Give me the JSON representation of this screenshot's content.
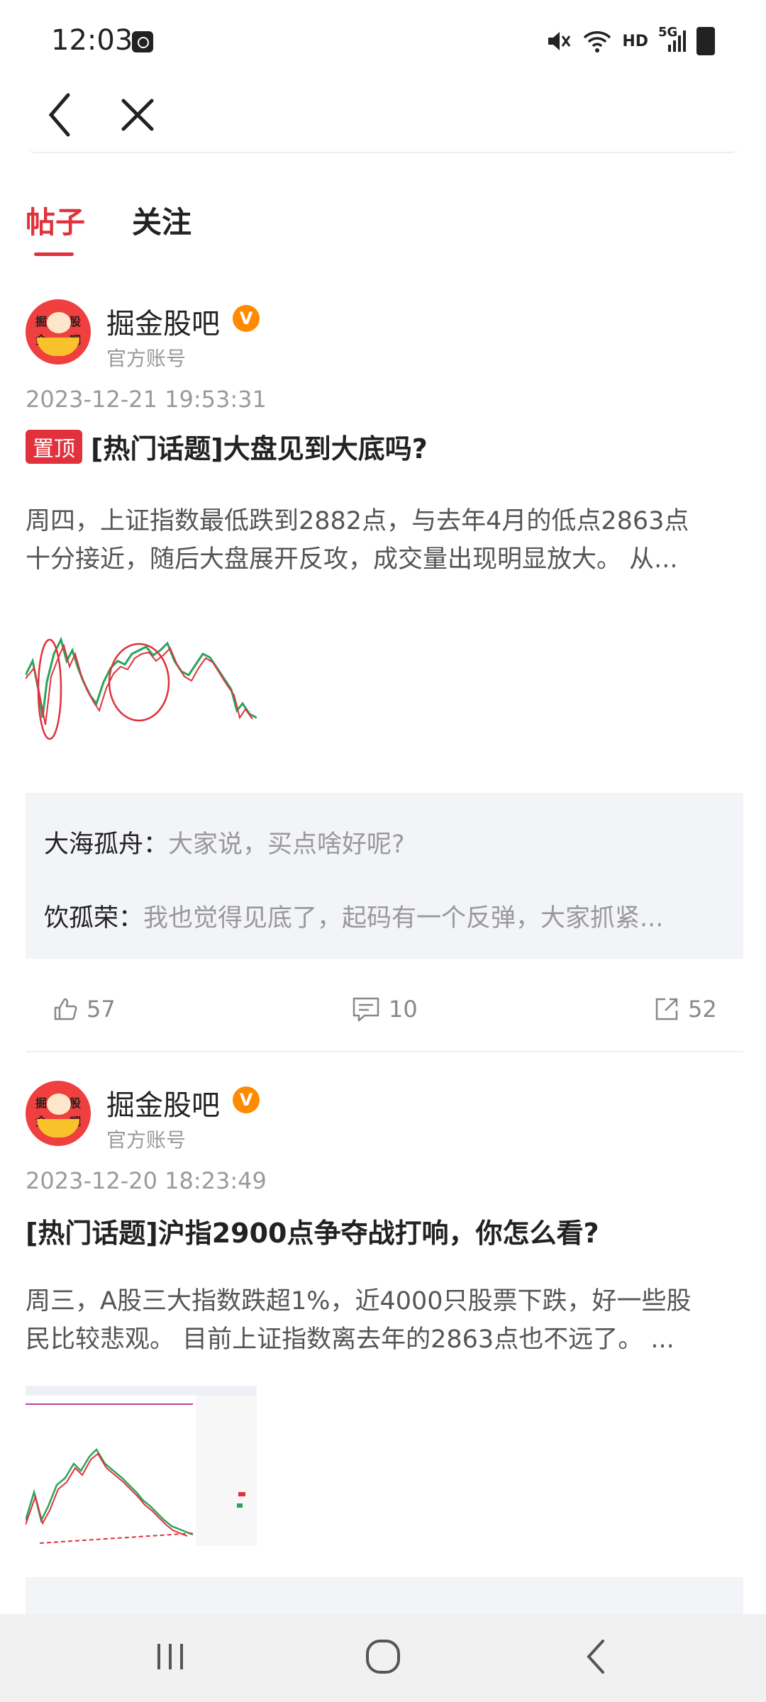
{
  "status": {
    "time": "12:03",
    "hd": "HD",
    "network": "5G"
  },
  "tabs": [
    {
      "label": "帖子"
    },
    {
      "label": "关注"
    }
  ],
  "posts": [
    {
      "author": "掘金股吧",
      "badge": "V",
      "account_type": "官方账号",
      "avatar_text": [
        "掘",
        "股",
        "金",
        "吧"
      ],
      "datetime": "2023-12-21 19:53:31",
      "pin_label": "置顶",
      "title": "[热门话题]大盘见到大底吗?",
      "body_lines": [
        "周四，上证指数最低跌到2882点，与去年4月的低点2863点",
        "十分接近，随后大盘展开反攻，成交量出现明显放大。 从..."
      ],
      "comments": [
        {
          "user": "大海孤舟：",
          "text": "大家说，买点啥好呢?"
        },
        {
          "user": "饮孤荣：",
          "text": "我也觉得见底了，起码有一个反弹，大家抓紧..."
        }
      ],
      "likes": "57",
      "comment_count": "10",
      "shares": "52"
    },
    {
      "author": "掘金股吧",
      "badge": "V",
      "account_type": "官方账号",
      "avatar_text": [
        "掘",
        "股",
        "金",
        "吧"
      ],
      "datetime": "2023-12-20 18:23:49",
      "title": "[热门话题]沪指2900点争夺战打响，你怎么看?",
      "body_lines": [
        "周三，A股三大指数跌超1%，近4000只股票下跌，好一些股",
        "民比较悲观。 目前上证指数离去年的2863点也不远了。 ..."
      ]
    }
  ],
  "colors": {
    "accent": "#e0313c",
    "badge": "#ff8a00",
    "muted": "#999999"
  }
}
